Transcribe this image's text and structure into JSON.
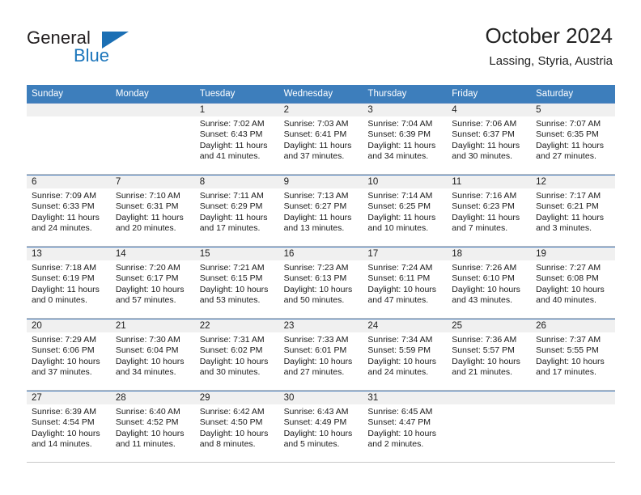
{
  "logo": {
    "primary_text": "General",
    "secondary_text": "Blue",
    "accent_color": "#1b75bb"
  },
  "header": {
    "title": "October 2024",
    "subtitle": "Lassing, Styria, Austria"
  },
  "calendar": {
    "header_color": "#3d7ebc",
    "weekdays": [
      "Sunday",
      "Monday",
      "Tuesday",
      "Wednesday",
      "Thursday",
      "Friday",
      "Saturday"
    ],
    "weeks": [
      [
        {
          "day": "",
          "sunrise": "",
          "sunset": "",
          "daylight": "",
          "empty": true
        },
        {
          "day": "",
          "sunrise": "",
          "sunset": "",
          "daylight": "",
          "empty": true
        },
        {
          "day": "1",
          "sunrise": "Sunrise: 7:02 AM",
          "sunset": "Sunset: 6:43 PM",
          "daylight": "Daylight: 11 hours and 41 minutes."
        },
        {
          "day": "2",
          "sunrise": "Sunrise: 7:03 AM",
          "sunset": "Sunset: 6:41 PM",
          "daylight": "Daylight: 11 hours and 37 minutes."
        },
        {
          "day": "3",
          "sunrise": "Sunrise: 7:04 AM",
          "sunset": "Sunset: 6:39 PM",
          "daylight": "Daylight: 11 hours and 34 minutes."
        },
        {
          "day": "4",
          "sunrise": "Sunrise: 7:06 AM",
          "sunset": "Sunset: 6:37 PM",
          "daylight": "Daylight: 11 hours and 30 minutes."
        },
        {
          "day": "5",
          "sunrise": "Sunrise: 7:07 AM",
          "sunset": "Sunset: 6:35 PM",
          "daylight": "Daylight: 11 hours and 27 minutes."
        }
      ],
      [
        {
          "day": "6",
          "sunrise": "Sunrise: 7:09 AM",
          "sunset": "Sunset: 6:33 PM",
          "daylight": "Daylight: 11 hours and 24 minutes."
        },
        {
          "day": "7",
          "sunrise": "Sunrise: 7:10 AM",
          "sunset": "Sunset: 6:31 PM",
          "daylight": "Daylight: 11 hours and 20 minutes."
        },
        {
          "day": "8",
          "sunrise": "Sunrise: 7:11 AM",
          "sunset": "Sunset: 6:29 PM",
          "daylight": "Daylight: 11 hours and 17 minutes."
        },
        {
          "day": "9",
          "sunrise": "Sunrise: 7:13 AM",
          "sunset": "Sunset: 6:27 PM",
          "daylight": "Daylight: 11 hours and 13 minutes."
        },
        {
          "day": "10",
          "sunrise": "Sunrise: 7:14 AM",
          "sunset": "Sunset: 6:25 PM",
          "daylight": "Daylight: 11 hours and 10 minutes."
        },
        {
          "day": "11",
          "sunrise": "Sunrise: 7:16 AM",
          "sunset": "Sunset: 6:23 PM",
          "daylight": "Daylight: 11 hours and 7 minutes."
        },
        {
          "day": "12",
          "sunrise": "Sunrise: 7:17 AM",
          "sunset": "Sunset: 6:21 PM",
          "daylight": "Daylight: 11 hours and 3 minutes."
        }
      ],
      [
        {
          "day": "13",
          "sunrise": "Sunrise: 7:18 AM",
          "sunset": "Sunset: 6:19 PM",
          "daylight": "Daylight: 11 hours and 0 minutes."
        },
        {
          "day": "14",
          "sunrise": "Sunrise: 7:20 AM",
          "sunset": "Sunset: 6:17 PM",
          "daylight": "Daylight: 10 hours and 57 minutes."
        },
        {
          "day": "15",
          "sunrise": "Sunrise: 7:21 AM",
          "sunset": "Sunset: 6:15 PM",
          "daylight": "Daylight: 10 hours and 53 minutes."
        },
        {
          "day": "16",
          "sunrise": "Sunrise: 7:23 AM",
          "sunset": "Sunset: 6:13 PM",
          "daylight": "Daylight: 10 hours and 50 minutes."
        },
        {
          "day": "17",
          "sunrise": "Sunrise: 7:24 AM",
          "sunset": "Sunset: 6:11 PM",
          "daylight": "Daylight: 10 hours and 47 minutes."
        },
        {
          "day": "18",
          "sunrise": "Sunrise: 7:26 AM",
          "sunset": "Sunset: 6:10 PM",
          "daylight": "Daylight: 10 hours and 43 minutes."
        },
        {
          "day": "19",
          "sunrise": "Sunrise: 7:27 AM",
          "sunset": "Sunset: 6:08 PM",
          "daylight": "Daylight: 10 hours and 40 minutes."
        }
      ],
      [
        {
          "day": "20",
          "sunrise": "Sunrise: 7:29 AM",
          "sunset": "Sunset: 6:06 PM",
          "daylight": "Daylight: 10 hours and 37 minutes."
        },
        {
          "day": "21",
          "sunrise": "Sunrise: 7:30 AM",
          "sunset": "Sunset: 6:04 PM",
          "daylight": "Daylight: 10 hours and 34 minutes."
        },
        {
          "day": "22",
          "sunrise": "Sunrise: 7:31 AM",
          "sunset": "Sunset: 6:02 PM",
          "daylight": "Daylight: 10 hours and 30 minutes."
        },
        {
          "day": "23",
          "sunrise": "Sunrise: 7:33 AM",
          "sunset": "Sunset: 6:01 PM",
          "daylight": "Daylight: 10 hours and 27 minutes."
        },
        {
          "day": "24",
          "sunrise": "Sunrise: 7:34 AM",
          "sunset": "Sunset: 5:59 PM",
          "daylight": "Daylight: 10 hours and 24 minutes."
        },
        {
          "day": "25",
          "sunrise": "Sunrise: 7:36 AM",
          "sunset": "Sunset: 5:57 PM",
          "daylight": "Daylight: 10 hours and 21 minutes."
        },
        {
          "day": "26",
          "sunrise": "Sunrise: 7:37 AM",
          "sunset": "Sunset: 5:55 PM",
          "daylight": "Daylight: 10 hours and 17 minutes."
        }
      ],
      [
        {
          "day": "27",
          "sunrise": "Sunrise: 6:39 AM",
          "sunset": "Sunset: 4:54 PM",
          "daylight": "Daylight: 10 hours and 14 minutes."
        },
        {
          "day": "28",
          "sunrise": "Sunrise: 6:40 AM",
          "sunset": "Sunset: 4:52 PM",
          "daylight": "Daylight: 10 hours and 11 minutes."
        },
        {
          "day": "29",
          "sunrise": "Sunrise: 6:42 AM",
          "sunset": "Sunset: 4:50 PM",
          "daylight": "Daylight: 10 hours and 8 minutes."
        },
        {
          "day": "30",
          "sunrise": "Sunrise: 6:43 AM",
          "sunset": "Sunset: 4:49 PM",
          "daylight": "Daylight: 10 hours and 5 minutes."
        },
        {
          "day": "31",
          "sunrise": "Sunrise: 6:45 AM",
          "sunset": "Sunset: 4:47 PM",
          "daylight": "Daylight: 10 hours and 2 minutes."
        },
        {
          "day": "",
          "sunrise": "",
          "sunset": "",
          "daylight": "",
          "empty": true
        },
        {
          "day": "",
          "sunrise": "",
          "sunset": "",
          "daylight": "",
          "empty": true
        }
      ]
    ]
  }
}
